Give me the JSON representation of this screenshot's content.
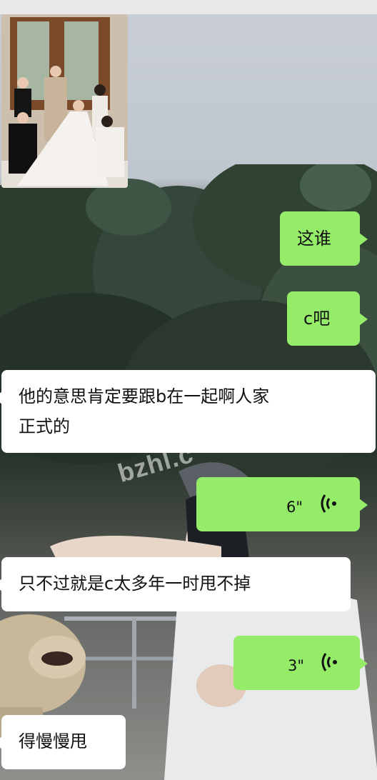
{
  "messages": [
    {
      "side": "left",
      "type": "image"
    },
    {
      "side": "right",
      "type": "text",
      "text": "这谁"
    },
    {
      "side": "right",
      "type": "text",
      "text": "c吧"
    },
    {
      "side": "left",
      "type": "text",
      "text_line1": "他的意思肯定要跟b在一起啊人家",
      "text_line2": "正式的"
    },
    {
      "side": "right",
      "type": "voice",
      "duration": "6\""
    },
    {
      "side": "left",
      "type": "text",
      "text": "只不过就是c太多年一时甩不掉"
    },
    {
      "side": "right",
      "type": "voice",
      "duration": "3\""
    },
    {
      "side": "left",
      "type": "text",
      "text": "得慢慢甩"
    }
  ],
  "watermark": "bzhl.c",
  "colors": {
    "sent_bubble": "#95ec69",
    "received_bubble": "#ffffff"
  },
  "icons": [
    "voice-wave-icon"
  ]
}
